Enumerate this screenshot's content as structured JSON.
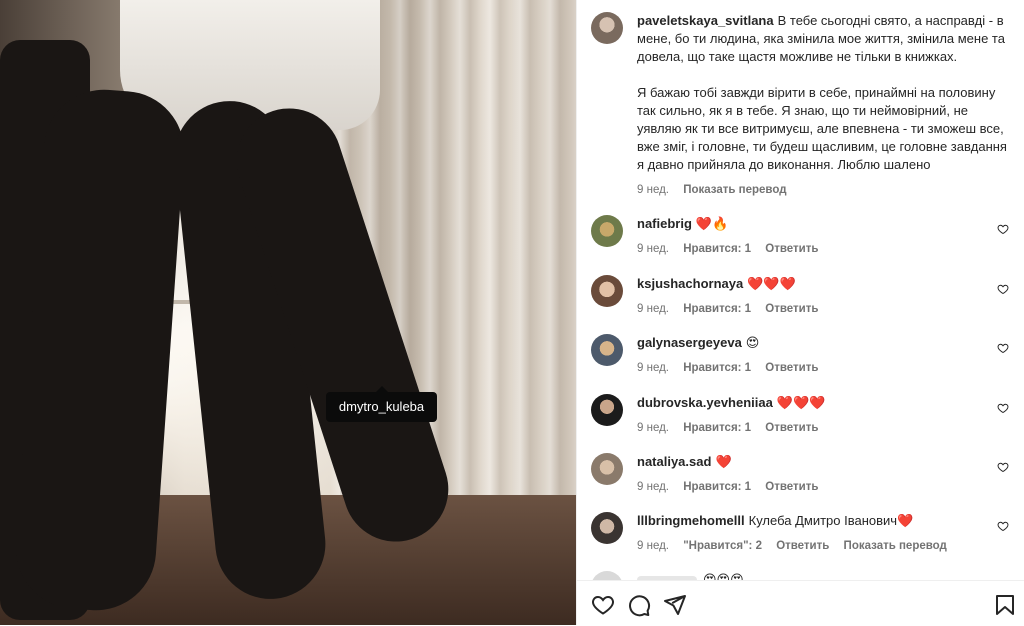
{
  "photo": {
    "tag_username": "dmytro_kuleba"
  },
  "caption": {
    "username": "paveletskaya_svitlana",
    "text1": "В тебе сьогодні свято, а насправді - в мене, бо ти людина, яка змінила мое життя, змінила мене та довела, що таке щастя можливе не тільки в книжках.",
    "text2": "Я бажаю тобі завжди вірити в себе, принаймні на половину так сильно, як я в тебе. Я знаю, що ти неймовірний, не уявляю як ти все витримуєш, але впевнена - ти зможеш все, вже зміг, і головне, ти будеш щасливим, це головне завдання я давно прийняла до виконання. Люблю шалено",
    "time": "9 нед.",
    "translate": "Показать перевод"
  },
  "comments": [
    {
      "username": "nafiebrig",
      "text": "❤️🔥",
      "time": "9 нед.",
      "likes": "Нравится: 1",
      "reply": "Ответить"
    },
    {
      "username": "ksjushachornaya",
      "text": "❤️❤️❤️",
      "time": "9 нед.",
      "likes": "Нравится: 1",
      "reply": "Ответить"
    },
    {
      "username": "galynasergeyeva",
      "text": "😍",
      "time": "9 нед.",
      "likes": "Нравится: 1",
      "reply": "Ответить"
    },
    {
      "username": "dubrovska.yevheniiaa",
      "text": "❤️❤️❤️",
      "time": "9 нед.",
      "likes": "Нравится: 1",
      "reply": "Ответить"
    },
    {
      "username": "nataliya.sad",
      "text": "❤️",
      "time": "9 нед.",
      "likes": "Нравится: 1",
      "reply": "Ответить"
    },
    {
      "username": "lllbringmehomelll",
      "text": "Кулеба Дмитро Іванович❤️",
      "time": "9 нед.",
      "likes": "\"Нравится\": 2",
      "reply": "Ответить",
      "translate": "Показать перевод"
    }
  ],
  "partial_comment": {
    "text": "😍😍😍"
  },
  "colors": {
    "text": "#262626",
    "secondary": "#737373",
    "heart": "#ed4956"
  },
  "icons": [
    "heart-icon",
    "comment-icon",
    "share-icon",
    "bookmark-icon"
  ]
}
